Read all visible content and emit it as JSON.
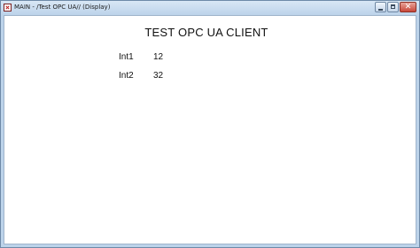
{
  "window": {
    "title": "MAIN - /Test OPC UA// (Display)"
  },
  "icons": {
    "app": "app-icon",
    "minimize": "minimize-icon",
    "maximize": "maximize-icon",
    "close": "close-icon"
  },
  "caption": {
    "close_glyph": "✕"
  },
  "main": {
    "title": "TEST OPC UA CLIENT",
    "variables": [
      {
        "label": "Int1",
        "value": "12"
      },
      {
        "label": "Int2",
        "value": "32"
      }
    ]
  }
}
